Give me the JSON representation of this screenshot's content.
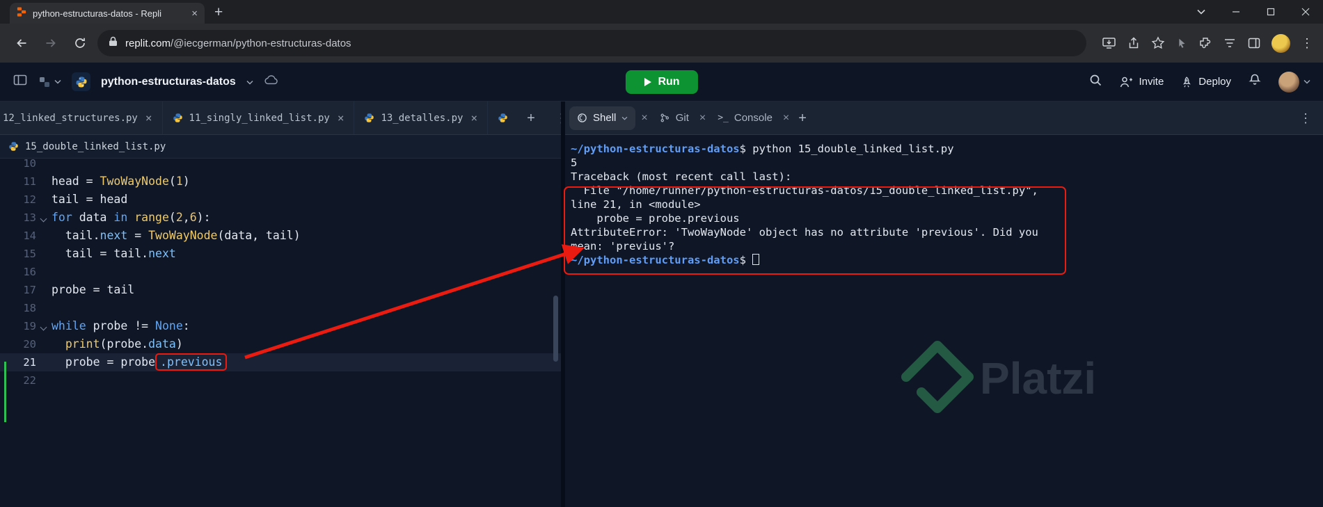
{
  "colors": {
    "annotation_red": "#ea1b10",
    "run_green": "#0d9331",
    "python_blue": "#3b77bc",
    "python_yellow": "#f5c542",
    "platzi_green": "#3fae6a",
    "keyword_blue": "#61a5f4",
    "function_yellow": "#f0ca6a",
    "property_blue": "#7cc0fd",
    "number_gold": "#e2c484",
    "path_blue": "#5f9df8",
    "replit_orange": "#f26207"
  },
  "glyphs": {
    "close": "×",
    "plus": "+",
    "kebab": "⋮",
    "console_icon": ">_"
  },
  "browser": {
    "tab_title": "python-estructuras-datos - Repli",
    "url_domain": "replit.com",
    "url_path": "/@iecgerman/python-estructuras-datos"
  },
  "header": {
    "project": "python-estructuras-datos",
    "run": "Run",
    "invite": "Invite",
    "deploy": "Deploy"
  },
  "editor": {
    "tabs": [
      {
        "label": "12_linked_structures.py"
      },
      {
        "label": "11_singly_linked_list.py"
      },
      {
        "label": "13_detalles.py"
      }
    ],
    "active_file": "15_double_linked_list.py",
    "lines": [
      {
        "num": "10",
        "tokens": []
      },
      {
        "num": "11",
        "tokens": [
          {
            "t": "head = ",
            "c": "plain"
          },
          {
            "t": "TwoWayNode",
            "c": "func"
          },
          {
            "t": "(",
            "c": "plain"
          },
          {
            "t": "1",
            "c": "num"
          },
          {
            "t": ")",
            "c": "plain"
          }
        ]
      },
      {
        "num": "12",
        "tokens": [
          {
            "t": "tail = head",
            "c": "plain"
          }
        ]
      },
      {
        "num": "13",
        "fold": true,
        "tokens": [
          {
            "t": "for",
            "c": "kw"
          },
          {
            "t": " data ",
            "c": "plain"
          },
          {
            "t": "in",
            "c": "kw"
          },
          {
            "t": " ",
            "c": "plain"
          },
          {
            "t": "range",
            "c": "func"
          },
          {
            "t": "(",
            "c": "plain"
          },
          {
            "t": "2",
            "c": "num"
          },
          {
            "t": ",",
            "c": "plain"
          },
          {
            "t": "6",
            "c": "num"
          },
          {
            "t": "):",
            "c": "plain"
          }
        ]
      },
      {
        "num": "14",
        "tokens": [
          {
            "t": "  tail",
            "c": "plain"
          },
          {
            "t": ".",
            "c": "plain"
          },
          {
            "t": "next",
            "c": "prop"
          },
          {
            "t": " = ",
            "c": "plain"
          },
          {
            "t": "TwoWayNode",
            "c": "func"
          },
          {
            "t": "(data, tail)",
            "c": "plain"
          }
        ]
      },
      {
        "num": "15",
        "tokens": [
          {
            "t": "  tail = tail",
            "c": "plain"
          },
          {
            "t": ".",
            "c": "plain"
          },
          {
            "t": "next",
            "c": "prop"
          }
        ]
      },
      {
        "num": "16",
        "tokens": []
      },
      {
        "num": "17",
        "tokens": [
          {
            "t": "probe = tail",
            "c": "plain"
          }
        ]
      },
      {
        "num": "18",
        "tokens": []
      },
      {
        "num": "19",
        "fold": true,
        "tokens": [
          {
            "t": "while",
            "c": "kw"
          },
          {
            "t": " probe != ",
            "c": "plain"
          },
          {
            "t": "None",
            "c": "kw"
          },
          {
            "t": ":",
            "c": "plain"
          }
        ]
      },
      {
        "num": "20",
        "tokens": [
          {
            "t": "  ",
            "c": "plain"
          },
          {
            "t": "print",
            "c": "func"
          },
          {
            "t": "(probe",
            "c": "plain"
          },
          {
            "t": ".",
            "c": "plain"
          },
          {
            "t": "data",
            "c": "prop"
          },
          {
            "t": ")",
            "c": "plain"
          }
        ]
      },
      {
        "num": "21",
        "current": true,
        "tokens": [
          {
            "t": "  probe = probe",
            "c": "plain"
          },
          {
            "t": ".previous",
            "c": "prop",
            "box": true
          }
        ]
      },
      {
        "num": "22",
        "tokens": []
      }
    ]
  },
  "shell": {
    "tabs": [
      {
        "label": "Shell"
      },
      {
        "label": "Git"
      },
      {
        "label": "Console"
      }
    ],
    "lines": [
      {
        "tokens": [
          {
            "t": "~/python-estructuras-datos",
            "c": "path"
          },
          {
            "t": "$ python 15_double_linked_list.py",
            "c": "plain"
          }
        ]
      },
      {
        "tokens": [
          {
            "t": "5",
            "c": "plain"
          }
        ]
      },
      {
        "tokens": [
          {
            "t": "Traceback (most recent call last):",
            "c": "plain"
          }
        ]
      },
      {
        "tokens": [
          {
            "t": "  File \"/home/runner/python-estructuras-datos/15_double_linked_list.py\",",
            "c": "plain"
          }
        ]
      },
      {
        "tokens": [
          {
            "t": "line 21, in <module>",
            "c": "plain"
          }
        ]
      },
      {
        "tokens": [
          {
            "t": "    probe = probe.previous",
            "c": "plain"
          }
        ]
      },
      {
        "tokens": [
          {
            "t": "AttributeError: 'TwoWayNode' object has no attribute 'previous'. Did you",
            "c": "plain"
          }
        ]
      },
      {
        "tokens": [
          {
            "t": "mean: 'previus'?",
            "c": "plain"
          }
        ]
      },
      {
        "tokens": [
          {
            "t": "~/python-estructuras-datos",
            "c": "path"
          },
          {
            "t": "$ ",
            "c": "plain"
          },
          {
            "t": "",
            "c": "cursor"
          }
        ]
      }
    ]
  },
  "watermark": {
    "text": "Platzi"
  }
}
